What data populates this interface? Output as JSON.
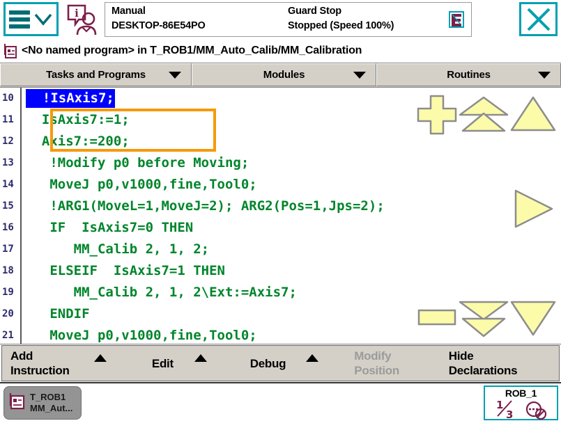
{
  "header": {
    "menu_icon": "hamburger-menu-icon",
    "info_icon": "operator-info-icon",
    "mode": "Manual",
    "controller": "DESKTOP-86E54PO",
    "guard_state": "Guard Stop",
    "run_state": "Stopped (Speed 100%)",
    "hold_icon": "motors-on-hold-icon",
    "close_icon": "close-icon",
    "accent_color": "#00a0b0",
    "accent_dark": "#006d75",
    "magenta": "#7b1f4b"
  },
  "path_bar": {
    "icon": "program-file-icon",
    "text": "<No named program> in T_ROB1/MM_Auto_Calib/MM_Calibration"
  },
  "tabs": [
    {
      "label": "Tasks and Programs",
      "arrow": "chevron-down-icon"
    },
    {
      "label": "Modules",
      "arrow": "chevron-down-icon"
    },
    {
      "label": "Routines",
      "arrow": "chevron-down-icon"
    }
  ],
  "editor": {
    "selected_line_number": 10,
    "selection_bg": "#0000ff",
    "selection_fg": "#ffffff",
    "code_color": "#00852b",
    "gutter_color": "#2b2b6b",
    "edit_box_color": "#f59a0b",
    "lines": [
      {
        "num": "10",
        "text": "  !IsAxis7;",
        "selected": true
      },
      {
        "num": "11",
        "text": "  IsAxis7:=1;",
        "selected": false
      },
      {
        "num": "12",
        "text": "  Axis7:=200;",
        "selected": false
      },
      {
        "num": "13",
        "text": "   !Modify p0 before Moving;",
        "selected": false
      },
      {
        "num": "14",
        "text": "   MoveJ p0,v1000,fine,Tool0;",
        "selected": false
      },
      {
        "num": "15",
        "text": "   !ARG1(MoveL=1,MoveJ=2); ARG2(Pos=1,Jps=2);",
        "selected": false
      },
      {
        "num": "16",
        "text": "   IF  IsAxis7=0 THEN",
        "selected": false
      },
      {
        "num": "17",
        "text": "      MM_Calib 2, 1, 2;",
        "selected": false
      },
      {
        "num": "18",
        "text": "   ELSEIF  IsAxis7=1 THEN",
        "selected": false
      },
      {
        "num": "19",
        "text": "      MM_Calib 2, 1, 2\\Ext:=Axis7;",
        "selected": false
      },
      {
        "num": "20",
        "text": "   ENDIF",
        "selected": false
      },
      {
        "num": "21",
        "text": "   MoveJ p0,v1000,fine,Tool0;",
        "selected": false
      }
    ]
  },
  "nav_buttons": [
    {
      "name": "add-instruction-plus-button",
      "shape": "plus"
    },
    {
      "name": "page-up-button",
      "shape": "double-up"
    },
    {
      "name": "line-up-button",
      "shape": "up"
    },
    {
      "name": "step-right-button",
      "shape": "right"
    },
    {
      "name": "collapse-button",
      "shape": "bar"
    },
    {
      "name": "page-down-button",
      "shape": "double-down"
    },
    {
      "name": "line-down-button",
      "shape": "down"
    }
  ],
  "toolbar": {
    "add_instruction": "Add\nInstruction",
    "edit": "Edit",
    "debug": "Debug",
    "modify_position": "Modify\nPosition",
    "modify_position_disabled": true,
    "hide_declarations": "Hide\nDeclarations",
    "caret_icon": "caret-up-icon"
  },
  "status_bar": {
    "task_icon": "task-program-icon",
    "task_name": "T_ROB1",
    "task_module": "MM_Aut...",
    "robot_label": "ROB_1",
    "fraction": "1/3",
    "fraction_numerator": "1",
    "fraction_denominator": "3",
    "motion_icon": "motion-disabled-icon"
  }
}
